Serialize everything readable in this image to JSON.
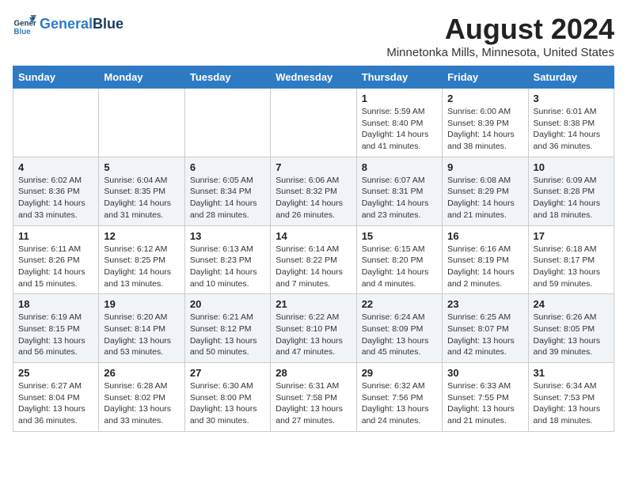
{
  "logo": {
    "line1": "General",
    "line2": "Blue"
  },
  "header": {
    "title": "August 2024",
    "location": "Minnetonka Mills, Minnesota, United States"
  },
  "weekdays": [
    "Sunday",
    "Monday",
    "Tuesday",
    "Wednesday",
    "Thursday",
    "Friday",
    "Saturday"
  ],
  "weeks": [
    [
      {
        "day": "",
        "info": ""
      },
      {
        "day": "",
        "info": ""
      },
      {
        "day": "",
        "info": ""
      },
      {
        "day": "",
        "info": ""
      },
      {
        "day": "1",
        "info": "Sunrise: 5:59 AM\nSunset: 8:40 PM\nDaylight: 14 hours\nand 41 minutes."
      },
      {
        "day": "2",
        "info": "Sunrise: 6:00 AM\nSunset: 8:39 PM\nDaylight: 14 hours\nand 38 minutes."
      },
      {
        "day": "3",
        "info": "Sunrise: 6:01 AM\nSunset: 8:38 PM\nDaylight: 14 hours\nand 36 minutes."
      }
    ],
    [
      {
        "day": "4",
        "info": "Sunrise: 6:02 AM\nSunset: 8:36 PM\nDaylight: 14 hours\nand 33 minutes."
      },
      {
        "day": "5",
        "info": "Sunrise: 6:04 AM\nSunset: 8:35 PM\nDaylight: 14 hours\nand 31 minutes."
      },
      {
        "day": "6",
        "info": "Sunrise: 6:05 AM\nSunset: 8:34 PM\nDaylight: 14 hours\nand 28 minutes."
      },
      {
        "day": "7",
        "info": "Sunrise: 6:06 AM\nSunset: 8:32 PM\nDaylight: 14 hours\nand 26 minutes."
      },
      {
        "day": "8",
        "info": "Sunrise: 6:07 AM\nSunset: 8:31 PM\nDaylight: 14 hours\nand 23 minutes."
      },
      {
        "day": "9",
        "info": "Sunrise: 6:08 AM\nSunset: 8:29 PM\nDaylight: 14 hours\nand 21 minutes."
      },
      {
        "day": "10",
        "info": "Sunrise: 6:09 AM\nSunset: 8:28 PM\nDaylight: 14 hours\nand 18 minutes."
      }
    ],
    [
      {
        "day": "11",
        "info": "Sunrise: 6:11 AM\nSunset: 8:26 PM\nDaylight: 14 hours\nand 15 minutes."
      },
      {
        "day": "12",
        "info": "Sunrise: 6:12 AM\nSunset: 8:25 PM\nDaylight: 14 hours\nand 13 minutes."
      },
      {
        "day": "13",
        "info": "Sunrise: 6:13 AM\nSunset: 8:23 PM\nDaylight: 14 hours\nand 10 minutes."
      },
      {
        "day": "14",
        "info": "Sunrise: 6:14 AM\nSunset: 8:22 PM\nDaylight: 14 hours\nand 7 minutes."
      },
      {
        "day": "15",
        "info": "Sunrise: 6:15 AM\nSunset: 8:20 PM\nDaylight: 14 hours\nand 4 minutes."
      },
      {
        "day": "16",
        "info": "Sunrise: 6:16 AM\nSunset: 8:19 PM\nDaylight: 14 hours\nand 2 minutes."
      },
      {
        "day": "17",
        "info": "Sunrise: 6:18 AM\nSunset: 8:17 PM\nDaylight: 13 hours\nand 59 minutes."
      }
    ],
    [
      {
        "day": "18",
        "info": "Sunrise: 6:19 AM\nSunset: 8:15 PM\nDaylight: 13 hours\nand 56 minutes."
      },
      {
        "day": "19",
        "info": "Sunrise: 6:20 AM\nSunset: 8:14 PM\nDaylight: 13 hours\nand 53 minutes."
      },
      {
        "day": "20",
        "info": "Sunrise: 6:21 AM\nSunset: 8:12 PM\nDaylight: 13 hours\nand 50 minutes."
      },
      {
        "day": "21",
        "info": "Sunrise: 6:22 AM\nSunset: 8:10 PM\nDaylight: 13 hours\nand 47 minutes."
      },
      {
        "day": "22",
        "info": "Sunrise: 6:24 AM\nSunset: 8:09 PM\nDaylight: 13 hours\nand 45 minutes."
      },
      {
        "day": "23",
        "info": "Sunrise: 6:25 AM\nSunset: 8:07 PM\nDaylight: 13 hours\nand 42 minutes."
      },
      {
        "day": "24",
        "info": "Sunrise: 6:26 AM\nSunset: 8:05 PM\nDaylight: 13 hours\nand 39 minutes."
      }
    ],
    [
      {
        "day": "25",
        "info": "Sunrise: 6:27 AM\nSunset: 8:04 PM\nDaylight: 13 hours\nand 36 minutes."
      },
      {
        "day": "26",
        "info": "Sunrise: 6:28 AM\nSunset: 8:02 PM\nDaylight: 13 hours\nand 33 minutes."
      },
      {
        "day": "27",
        "info": "Sunrise: 6:30 AM\nSunset: 8:00 PM\nDaylight: 13 hours\nand 30 minutes."
      },
      {
        "day": "28",
        "info": "Sunrise: 6:31 AM\nSunset: 7:58 PM\nDaylight: 13 hours\nand 27 minutes."
      },
      {
        "day": "29",
        "info": "Sunrise: 6:32 AM\nSunset: 7:56 PM\nDaylight: 13 hours\nand 24 minutes."
      },
      {
        "day": "30",
        "info": "Sunrise: 6:33 AM\nSunset: 7:55 PM\nDaylight: 13 hours\nand 21 minutes."
      },
      {
        "day": "31",
        "info": "Sunrise: 6:34 AM\nSunset: 7:53 PM\nDaylight: 13 hours\nand 18 minutes."
      }
    ]
  ]
}
